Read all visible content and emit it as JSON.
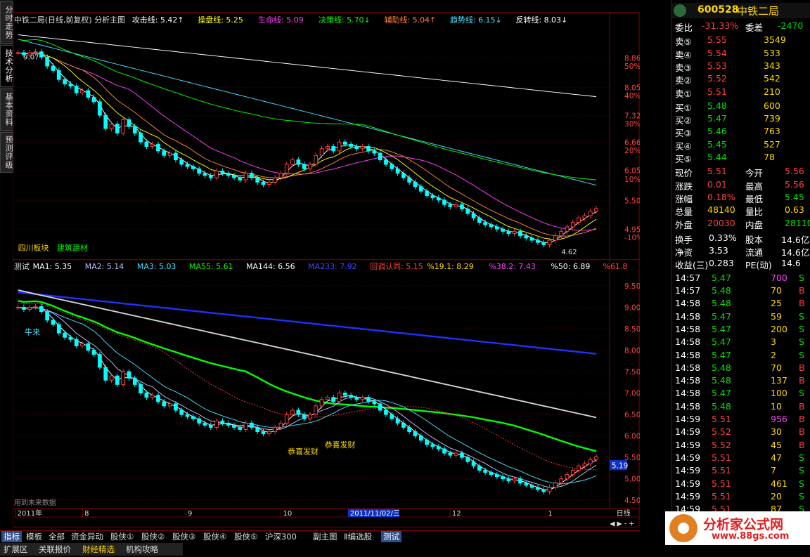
{
  "left_tabs": [
    "分时走势",
    "技术分析",
    "基本资料",
    "预测评级"
  ],
  "main_header": {
    "name": "中铁二局(日线,前复权) 分析主图",
    "items": [
      {
        "label": "攻击线: 5.42↑",
        "color": "#ffffff"
      },
      {
        "label": "操盘线: 5.25",
        "color": "#ffff00"
      },
      {
        "label": "生命线: 5.09",
        "color": "#ff40ff"
      },
      {
        "label": "决策线: 5.70↓",
        "color": "#00ff00"
      },
      {
        "label": "辅助线: 5.04↑",
        "color": "#ff8040"
      },
      {
        "label": "趋势线: 6.15↓",
        "color": "#40e0ff"
      },
      {
        "label": "反转线: 8.03↓",
        "color": "#ffffff"
      }
    ]
  },
  "main_axis": {
    "labels": [
      "8.86",
      "50%",
      "8.05",
      "40%",
      "7.32",
      "30%",
      "6.66",
      "20%",
      "6.05",
      "10%",
      "5.50",
      "4.95",
      "-10%"
    ]
  },
  "main_annotations": {
    "sector": "四川板块",
    "industry": "建筑建材",
    "high_label": "9.07",
    "low_label": "4.62"
  },
  "sub_header": {
    "name": "测试",
    "items": [
      {
        "label": "MA1: 5.35",
        "color": "#ffffff"
      },
      {
        "label": "MA2: 5.14",
        "color": "#c0c0ff"
      },
      {
        "label": "MA3: 5.03",
        "color": "#40e0ff"
      },
      {
        "label": "MA55: 5.61",
        "color": "#00ff00"
      },
      {
        "label": "MA144: 6.56",
        "color": "#ffffff"
      },
      {
        "label": "MA233: 7.92",
        "color": "#4040ff"
      },
      {
        "label": "回调认同: 5.15",
        "color": "#ff4040"
      },
      {
        "label": "%19.1: 8.29",
        "color": "#ffd800"
      },
      {
        "label": "%38.2: 7.43",
        "color": "#ff40ff"
      },
      {
        "label": "%50: 6.89",
        "color": "#ffffff"
      },
      {
        "label": "%61.8",
        "color": "#ff4040"
      }
    ]
  },
  "sub_axis": {
    "labels": [
      "9.50",
      "9.00",
      "8.50",
      "8.00",
      "7.50",
      "7.00",
      "6.50",
      "6.00",
      "5.50",
      "5.00",
      "4.50"
    ],
    "current": "5.19"
  },
  "sub_annotations": {
    "niu": "牛来",
    "gx1": "恭喜发财",
    "gx2": "恭喜发财",
    "future": "用到未来数据"
  },
  "time_axis": {
    "labels": [
      "2011年",
      "8",
      "9",
      "10",
      "11",
      "12",
      "1"
    ],
    "cursor": "2011/11/02/三",
    "period": "日线"
  },
  "quote": {
    "code": "600528",
    "name": "中铁二局",
    "weibi_label": "委比",
    "weibi": "-31.33%",
    "weicha_label": "委差",
    "weicha": "-2470",
    "asks": [
      {
        "label": "卖⑤",
        "price": "5.55",
        "vol": "3549"
      },
      {
        "label": "卖④",
        "price": "5.54",
        "vol": "533"
      },
      {
        "label": "卖③",
        "price": "5.53",
        "vol": "343"
      },
      {
        "label": "卖②",
        "price": "5.52",
        "vol": "542"
      },
      {
        "label": "卖①",
        "price": "5.51",
        "vol": "210"
      }
    ],
    "bids": [
      {
        "label": "买①",
        "price": "5.48",
        "vol": "600"
      },
      {
        "label": "买②",
        "price": "5.47",
        "vol": "739"
      },
      {
        "label": "买③",
        "price": "5.46",
        "vol": "763"
      },
      {
        "label": "买④",
        "price": "5.45",
        "vol": "527"
      },
      {
        "label": "买⑤",
        "price": "5.44",
        "vol": "78"
      }
    ],
    "stats": [
      {
        "l1": "现价",
        "v1": "5.51",
        "c1": "red",
        "l2": "今开",
        "v2": "5.56",
        "c2": "red"
      },
      {
        "l1": "涨跌",
        "v1": "0.01",
        "c1": "red",
        "l2": "最高",
        "v2": "5.56",
        "c2": "red"
      },
      {
        "l1": "涨幅",
        "v1": "0.18%",
        "c1": "red",
        "l2": "最低",
        "v2": "5.45",
        "c2": "green"
      },
      {
        "l1": "总量",
        "v1": "48140",
        "c1": "yellow",
        "l2": "量比",
        "v2": "0.63",
        "c2": "yellow"
      },
      {
        "l1": "外盘",
        "v1": "20030",
        "c1": "red",
        "l2": "内盘",
        "v2": "28110",
        "c2": "green"
      }
    ],
    "stats2": [
      {
        "l1": "换手",
        "v1": "0.33%",
        "l2": "股本",
        "v2": "14.6亿"
      },
      {
        "l1": "净资",
        "v1": "3.53",
        "l2": "流通",
        "v2": "14.6亿"
      },
      {
        "l1": "收益(三)",
        "v1": "0.283",
        "l2": "PE(动)",
        "v2": "14.6"
      }
    ],
    "ticks": [
      {
        "t": "14:57",
        "p": "5.47",
        "v": "700",
        "s": "S",
        "pc": "green",
        "vc": "mag"
      },
      {
        "t": "14:57",
        "p": "5.48",
        "v": "70",
        "s": "B",
        "pc": "green",
        "vc": "yellow"
      },
      {
        "t": "14:58",
        "p": "5.48",
        "v": "25",
        "s": "B",
        "pc": "green",
        "vc": "yellow"
      },
      {
        "t": "14:58",
        "p": "5.47",
        "v": "59",
        "s": "S",
        "pc": "green",
        "vc": "yellow"
      },
      {
        "t": "14:58",
        "p": "5.47",
        "v": "200",
        "s": "S",
        "pc": "green",
        "vc": "yellow"
      },
      {
        "t": "14:58",
        "p": "5.47",
        "v": "3",
        "s": "S",
        "pc": "green",
        "vc": "yellow"
      },
      {
        "t": "14:58",
        "p": "5.47",
        "v": "2",
        "s": "S",
        "pc": "green",
        "vc": "yellow"
      },
      {
        "t": "14:58",
        "p": "5.48",
        "v": "70",
        "s": "B",
        "pc": "green",
        "vc": "yellow"
      },
      {
        "t": "14:58",
        "p": "5.48",
        "v": "137",
        "s": "B",
        "pc": "green",
        "vc": "yellow"
      },
      {
        "t": "14:58",
        "p": "5.47",
        "v": "100",
        "s": "S",
        "pc": "green",
        "vc": "yellow"
      },
      {
        "t": "14:58",
        "p": "5.48",
        "v": "10",
        "s": "B",
        "pc": "green",
        "vc": "yellow"
      },
      {
        "t": "14:59",
        "p": "5.51",
        "v": "956",
        "s": "B",
        "pc": "red",
        "vc": "mag"
      },
      {
        "t": "14:59",
        "p": "5.52",
        "v": "30",
        "s": "B",
        "pc": "red",
        "vc": "yellow"
      },
      {
        "t": "14:59",
        "p": "5.52",
        "v": "45",
        "s": "B",
        "pc": "red",
        "vc": "yellow"
      },
      {
        "t": "14:59",
        "p": "5.51",
        "v": "47",
        "s": "S",
        "pc": "red",
        "vc": "yellow"
      },
      {
        "t": "14:59",
        "p": "5.51",
        "v": "7",
        "s": "S",
        "pc": "red",
        "vc": "yellow"
      },
      {
        "t": "14:59",
        "p": "5.51",
        "v": "461",
        "s": "S",
        "pc": "red",
        "vc": "yellow"
      },
      {
        "t": "14:59",
        "p": "5.51",
        "v": "20",
        "s": "S",
        "pc": "red",
        "vc": "yellow"
      },
      {
        "t": "14:59",
        "p": "5.51",
        "v": "87",
        "s": "S",
        "pc": "red",
        "vc": "yellow"
      }
    ]
  },
  "bottom_tabs": [
    "指标",
    "模板",
    "全部",
    "资金异动",
    "股侠①",
    "股侠②",
    "股侠③",
    "股侠④",
    "股侠⑤",
    "沪深300",
    "副主图",
    "Ⅱ编选股",
    "测试"
  ],
  "bottom_tabs2": [
    "扩展区",
    "关联报价",
    "财经精选",
    "机构攻略"
  ],
  "watermark": {
    "text": "分析家公式网",
    "url": "www.88gs.com"
  },
  "colors": {
    "up": "#ff4040",
    "down": "#00ffff",
    "frame": "#800000"
  }
}
